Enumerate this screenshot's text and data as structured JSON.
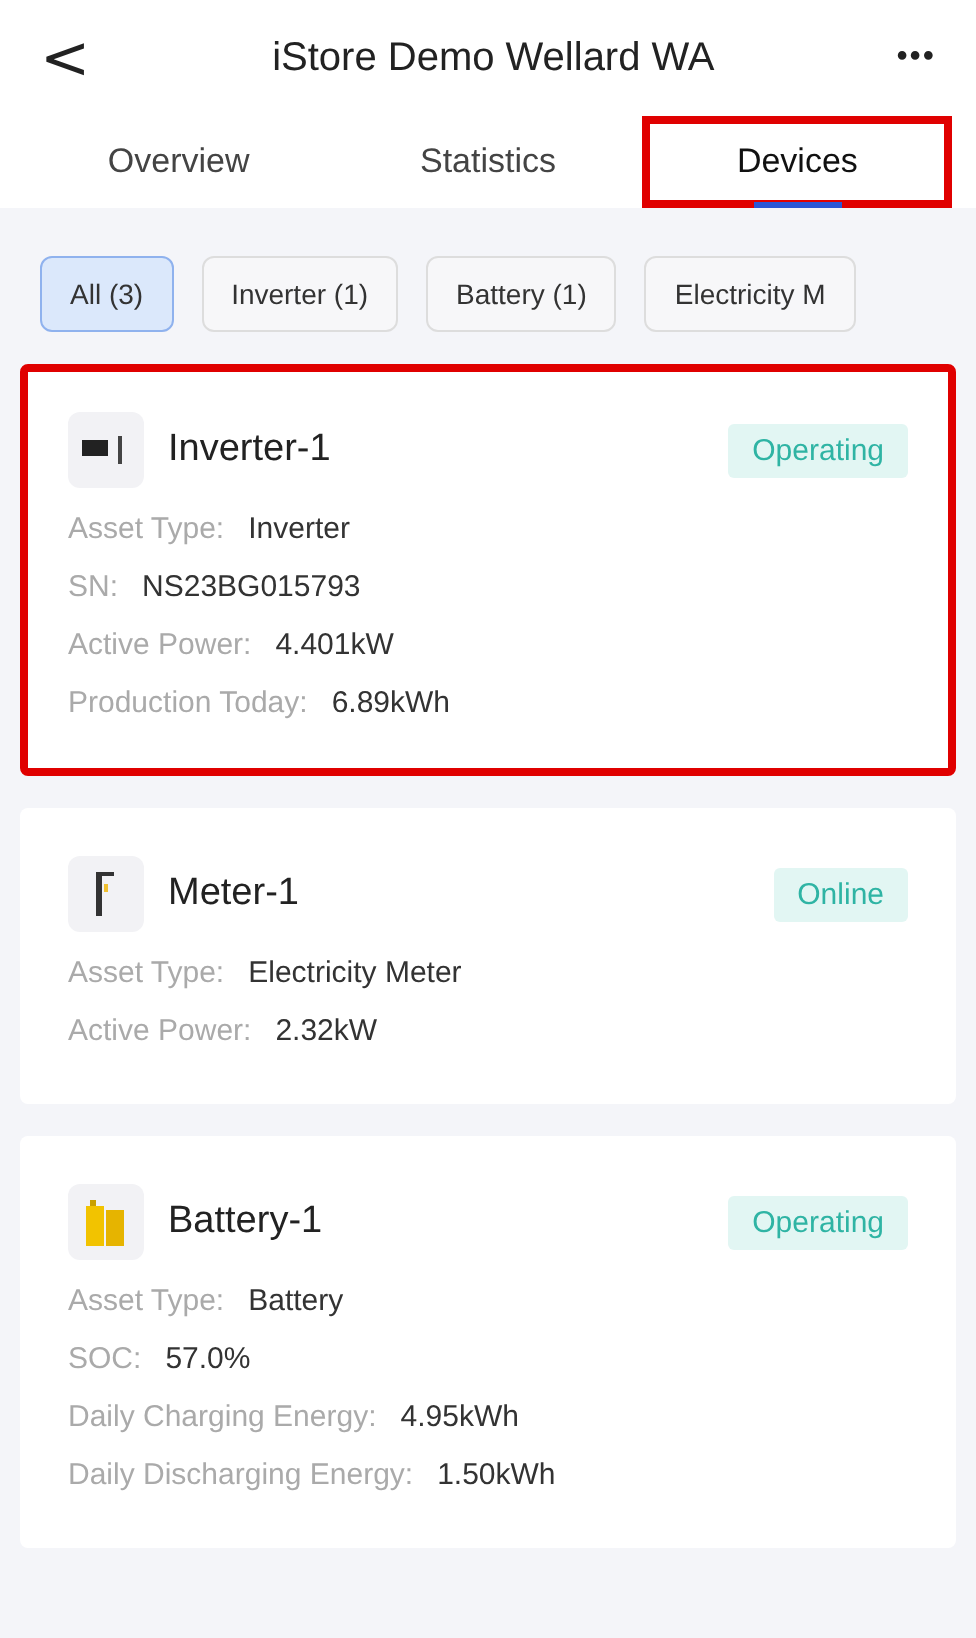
{
  "header": {
    "back": "<",
    "title": "iStore Demo Wellard WA",
    "more": "•••"
  },
  "tabs": [
    {
      "label": "Overview",
      "selected": false,
      "highlighted": false
    },
    {
      "label": "Statistics",
      "selected": false,
      "highlighted": false
    },
    {
      "label": "Devices",
      "selected": true,
      "highlighted": true
    }
  ],
  "filters": [
    {
      "label": "All (3)",
      "selected": true
    },
    {
      "label": "Inverter (1)",
      "selected": false
    },
    {
      "label": "Battery (1)",
      "selected": false
    },
    {
      "label": "Electricity M",
      "selected": false
    }
  ],
  "devices": [
    {
      "kind": "inverter",
      "name": "Inverter-1",
      "status": "Operating",
      "highlighted": true,
      "fields": [
        {
          "label": "Asset Type:",
          "value": "Inverter"
        },
        {
          "label": "SN:",
          "value": "NS23BG015793"
        },
        {
          "label": "Active Power:",
          "value": "4.401kW"
        },
        {
          "label": "Production Today:",
          "value": "6.89kWh"
        }
      ]
    },
    {
      "kind": "meter",
      "name": "Meter-1",
      "status": "Online",
      "highlighted": false,
      "fields": [
        {
          "label": "Asset Type:",
          "value": "Electricity Meter"
        },
        {
          "label": "Active Power:",
          "value": "2.32kW"
        }
      ]
    },
    {
      "kind": "battery",
      "name": "Battery-1",
      "status": "Operating",
      "highlighted": false,
      "fields": [
        {
          "label": "Asset Type:",
          "value": "Battery"
        },
        {
          "label": "SOC:",
          "value": "57.0%"
        },
        {
          "label": "Daily Charging Energy:",
          "value": "4.95kWh"
        },
        {
          "label": "Daily Discharging Energy:",
          "value": "1.50kWh"
        }
      ]
    }
  ]
}
